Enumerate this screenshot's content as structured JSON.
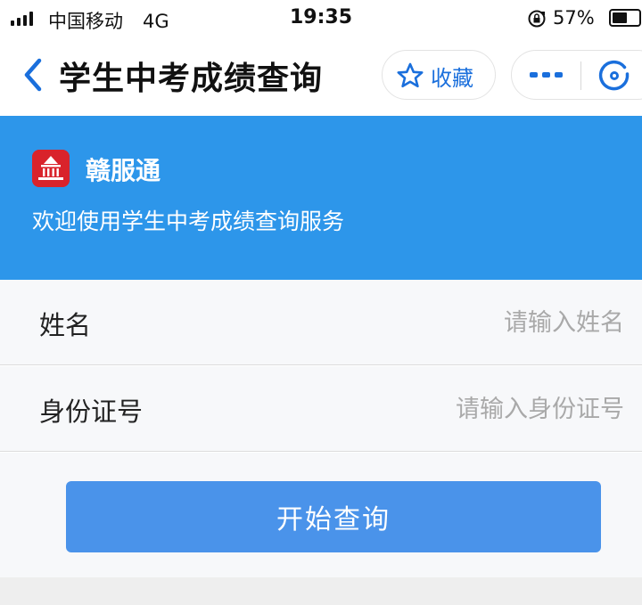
{
  "status_bar": {
    "carrier": "中国移动",
    "network": "4G",
    "time": "19:35",
    "battery": "57%",
    "battery_level": 0.57
  },
  "nav": {
    "title": "学生中考成绩查询",
    "favorite_label": "收藏",
    "icons": [
      "back-arrow-icon",
      "star-icon",
      "more-dots-icon",
      "close-icon"
    ]
  },
  "banner": {
    "brand": "赣服通",
    "welcome": "欢迎使用学生中考成绩查询服务",
    "background_color": "#2d96ea"
  },
  "form": {
    "fields": [
      {
        "label": "姓名",
        "placeholder": "请输入姓名",
        "value": ""
      },
      {
        "label": "身份证号",
        "placeholder": "请输入身份证号",
        "value": ""
      }
    ],
    "submit_label": "开始查询",
    "button_color": "#4a93ea"
  }
}
